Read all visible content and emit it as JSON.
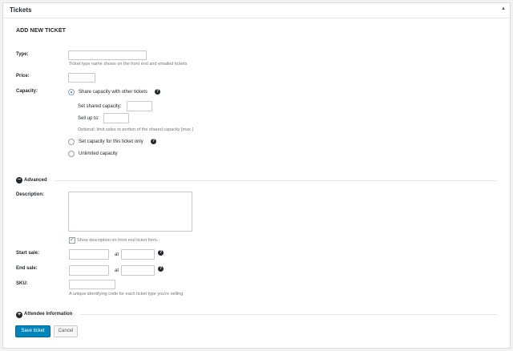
{
  "panel": {
    "title": "Tickets",
    "toggle_icon": "▲"
  },
  "form": {
    "heading": "ADD NEW TICKET",
    "type": {
      "label": "Type:",
      "value": "",
      "help": "Ticket type name shows on the front end and emailed tickets"
    },
    "price": {
      "label": "Price:",
      "value": ""
    },
    "capacity": {
      "label": "Capacity:",
      "options": [
        {
          "label": "Share capacity with other tickets",
          "checked": true
        },
        {
          "label": "Set capacity for this ticket only",
          "checked": false
        },
        {
          "label": "Unlimited capacity",
          "checked": false
        }
      ],
      "shared_label": "Set shared capacity:",
      "sell_up_to_label": "Sell up to:",
      "optional_help": "Optional: limit sales to portion of the shared capacity [max ]"
    },
    "advanced": {
      "label": "Advanced",
      "icon": "−"
    },
    "description": {
      "label": "Description:",
      "value": "",
      "show_checkbox_label": "Show description on front end ticket form.",
      "show_checked": true
    },
    "start_sale": {
      "label": "Start sale:",
      "at": "at"
    },
    "end_sale": {
      "label": "End sale:",
      "at": "at"
    },
    "sku": {
      "label": "SKU:",
      "value": "",
      "help": "A unique identifying code for each ticket type you're selling"
    },
    "attendee": {
      "label": "Attendee Information",
      "icon": "+"
    },
    "buttons": {
      "save": "Save ticket",
      "cancel": "Cancel"
    }
  }
}
